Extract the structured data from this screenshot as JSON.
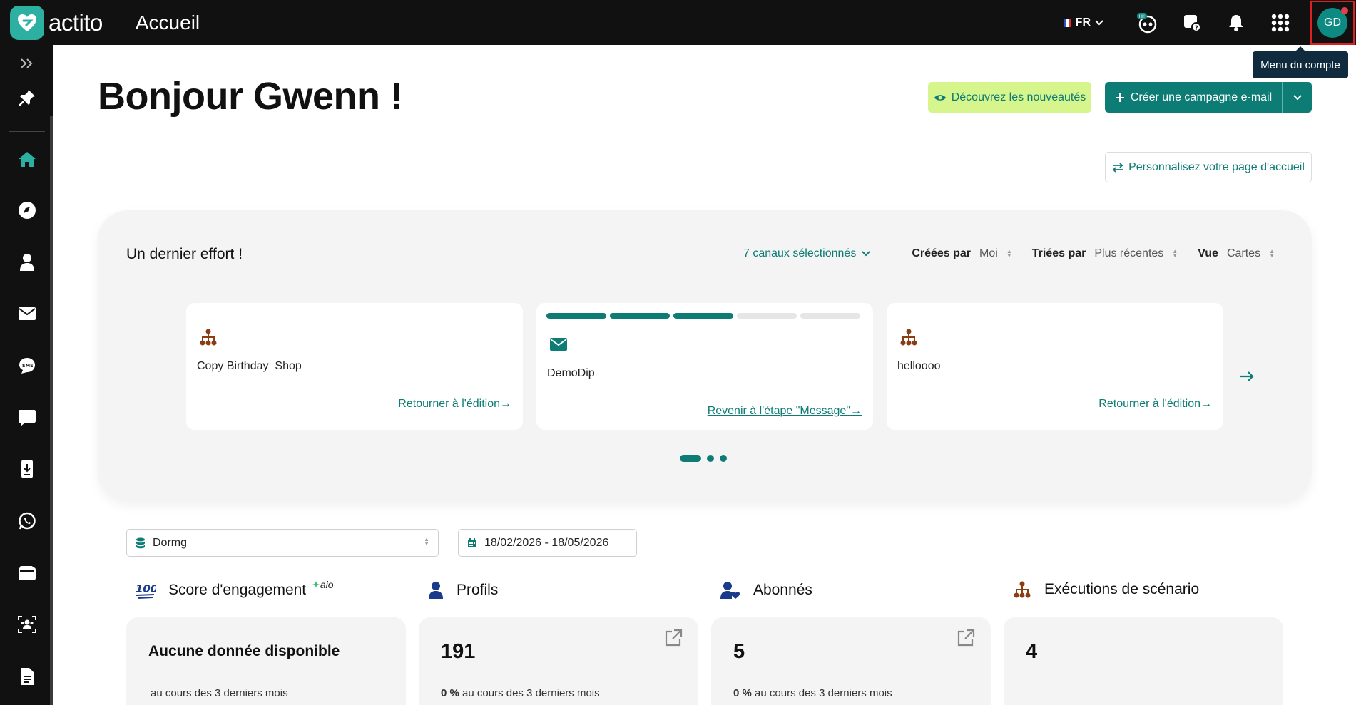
{
  "app": {
    "logo_text": "actito",
    "page_title": "Accueil"
  },
  "topbar": {
    "language": "FR",
    "icons": [
      "bot-hi-icon",
      "help-chat-icon",
      "bell-icon",
      "apps-grid-icon"
    ],
    "avatar_initials": "GD",
    "avatar_tooltip": "Menu du compte"
  },
  "sidebar": {
    "items": [
      "expand",
      "pin",
      "home",
      "explore",
      "profiles",
      "email",
      "sms",
      "chat",
      "mobile-push",
      "whatsapp",
      "wallet",
      "audience",
      "documents"
    ],
    "active": "home"
  },
  "greeting": "Bonjour Gwenn !",
  "buttons": {
    "news": "Découvrez les nouveautés",
    "create": "Créer une campagne e-mail",
    "customize": "Personnalisez votre page d'accueil"
  },
  "effort": {
    "title": "Un dernier effort !",
    "channels": "7 canaux sélectionnés",
    "created_by_label": "Créées par",
    "created_by_value": "Moi",
    "sorted_by_label": "Triées par",
    "sorted_by_value": "Plus récentes",
    "view_label": "Vue",
    "view_value": "Cartes",
    "cards": [
      {
        "icon": "scenario-icon",
        "name": "Copy Birthday_Shop",
        "link": "Retourner à l'édition→"
      },
      {
        "icon": "email-icon",
        "name": "DemoDip",
        "link": "Revenir à l'étape \"Message\"→",
        "progress_steps_done": 3,
        "progress_steps_total": 5
      },
      {
        "icon": "scenario-icon",
        "name": "helloooo",
        "link": "Retourner à l'édition→"
      }
    ],
    "pages": 3,
    "current_page": 1
  },
  "filters": {
    "database": "Dormg",
    "date_range": "18/02/2026 - 18/05/2026"
  },
  "stats": {
    "engagement": {
      "title": "Score d'engagement",
      "badge": "aio",
      "value": "Aucune donnée disponible",
      "sub": "au cours des 3 derniers mois"
    },
    "profiles": {
      "title": "Profils",
      "value": "191",
      "pct": "0 %",
      "sub": "au cours des 3 derniers mois"
    },
    "subscribers": {
      "title": "Abonnés",
      "value": "5",
      "pct": "0 %",
      "sub": "au cours des 3 derniers mois"
    },
    "scenarios": {
      "title": "Exécutions de scénario",
      "value": "4"
    }
  },
  "colors": {
    "brand": "#0d7c74",
    "accent_lime": "#d6f58c",
    "topbar": "#111111",
    "scenario_icon": "#8a3d12"
  }
}
